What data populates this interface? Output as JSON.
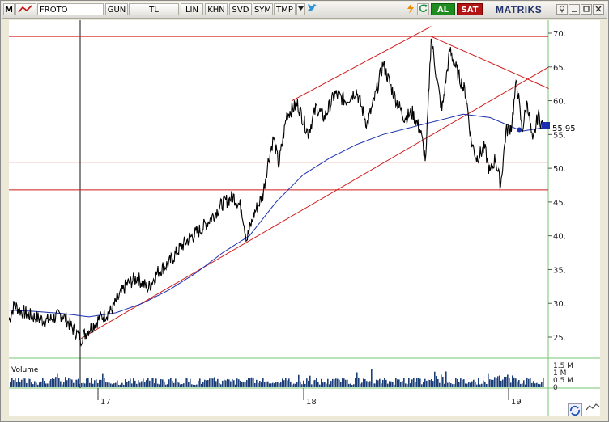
{
  "toolbar": {
    "menu_label": "M",
    "symbol": "FROTO",
    "period": "GUN",
    "currency": "TL",
    "scale": "LIN",
    "khn": "KHN",
    "svd": "SVD",
    "sym": "SYM",
    "tmp": "TMP",
    "buy_label": "AL",
    "sell_label": "SAT",
    "brand": "MATRIKS"
  },
  "chart_data": {
    "type": "line",
    "title": "",
    "price_axis_ticks": [
      "70.",
      "65.",
      "60.",
      "55.",
      "50.",
      "45.",
      "40.",
      "35.",
      "30.",
      "25."
    ],
    "last_price_label": "55.95",
    "volume_label": "Volume",
    "volume_ticks": [
      "1.5 M",
      "1 M",
      "0.5 M",
      "0"
    ],
    "x_ticks": [
      "17",
      "18",
      "19"
    ],
    "ylim": [
      22,
      72
    ],
    "price_series_waypoints": [
      {
        "t": 0.0,
        "v": 27.5
      },
      {
        "t": 0.01,
        "v": 29.8
      },
      {
        "t": 0.02,
        "v": 29.0
      },
      {
        "t": 0.04,
        "v": 28.2
      },
      {
        "t": 0.07,
        "v": 27.4
      },
      {
        "t": 0.1,
        "v": 28.4
      },
      {
        "t": 0.12,
        "v": 26.2
      },
      {
        "t": 0.135,
        "v": 24.8
      },
      {
        "t": 0.15,
        "v": 26.2
      },
      {
        "t": 0.17,
        "v": 27.8
      },
      {
        "t": 0.19,
        "v": 28.8
      },
      {
        "t": 0.22,
        "v": 32.8
      },
      {
        "t": 0.24,
        "v": 33.8
      },
      {
        "t": 0.26,
        "v": 32.2
      },
      {
        "t": 0.28,
        "v": 34.8
      },
      {
        "t": 0.3,
        "v": 36.0
      },
      {
        "t": 0.32,
        "v": 38.2
      },
      {
        "t": 0.34,
        "v": 39.8
      },
      {
        "t": 0.36,
        "v": 41.0
      },
      {
        "t": 0.38,
        "v": 42.8
      },
      {
        "t": 0.4,
        "v": 44.8
      },
      {
        "t": 0.42,
        "v": 45.8
      },
      {
        "t": 0.435,
        "v": 44.2
      },
      {
        "t": 0.445,
        "v": 39.5
      },
      {
        "t": 0.46,
        "v": 43.5
      },
      {
        "t": 0.475,
        "v": 46.0
      },
      {
        "t": 0.485,
        "v": 51.0
      },
      {
        "t": 0.495,
        "v": 54.5
      },
      {
        "t": 0.505,
        "v": 50.5
      },
      {
        "t": 0.52,
        "v": 58.0
      },
      {
        "t": 0.54,
        "v": 59.5
      },
      {
        "t": 0.56,
        "v": 55.2
      },
      {
        "t": 0.575,
        "v": 59.0
      },
      {
        "t": 0.59,
        "v": 57.5
      },
      {
        "t": 0.61,
        "v": 61.0
      },
      {
        "t": 0.63,
        "v": 60.0
      },
      {
        "t": 0.65,
        "v": 61.5
      },
      {
        "t": 0.67,
        "v": 56.5
      },
      {
        "t": 0.685,
        "v": 60.5
      },
      {
        "t": 0.7,
        "v": 65.5
      },
      {
        "t": 0.715,
        "v": 62.0
      },
      {
        "t": 0.725,
        "v": 60.0
      },
      {
        "t": 0.74,
        "v": 57.5
      },
      {
        "t": 0.755,
        "v": 58.2
      },
      {
        "t": 0.77,
        "v": 55.5
      },
      {
        "t": 0.78,
        "v": 51.0
      },
      {
        "t": 0.79,
        "v": 69.5
      },
      {
        "t": 0.8,
        "v": 63.5
      },
      {
        "t": 0.81,
        "v": 58.5
      },
      {
        "t": 0.825,
        "v": 67.5
      },
      {
        "t": 0.84,
        "v": 64.0
      },
      {
        "t": 0.855,
        "v": 61.0
      },
      {
        "t": 0.865,
        "v": 54.0
      },
      {
        "t": 0.875,
        "v": 51.5
      },
      {
        "t": 0.89,
        "v": 53.0
      },
      {
        "t": 0.9,
        "v": 49.2
      },
      {
        "t": 0.91,
        "v": 51.5
      },
      {
        "t": 0.92,
        "v": 47.5
      },
      {
        "t": 0.93,
        "v": 55.5
      },
      {
        "t": 0.94,
        "v": 56.2
      },
      {
        "t": 0.95,
        "v": 63.0
      },
      {
        "t": 0.96,
        "v": 55.5
      },
      {
        "t": 0.97,
        "v": 60.0
      },
      {
        "t": 0.98,
        "v": 53.5
      },
      {
        "t": 0.99,
        "v": 58.0
      },
      {
        "t": 1.0,
        "v": 55.9
      }
    ],
    "moving_average_waypoints": [
      {
        "t": 0.0,
        "v": 29.0
      },
      {
        "t": 0.05,
        "v": 28.8
      },
      {
        "t": 0.1,
        "v": 28.5
      },
      {
        "t": 0.15,
        "v": 28.0
      },
      {
        "t": 0.2,
        "v": 28.6
      },
      {
        "t": 0.25,
        "v": 30.0
      },
      {
        "t": 0.3,
        "v": 32.0
      },
      {
        "t": 0.35,
        "v": 34.5
      },
      {
        "t": 0.4,
        "v": 37.5
      },
      {
        "t": 0.45,
        "v": 40.0
      },
      {
        "t": 0.5,
        "v": 45.0
      },
      {
        "t": 0.55,
        "v": 49.0
      },
      {
        "t": 0.6,
        "v": 51.5
      },
      {
        "t": 0.65,
        "v": 53.5
      },
      {
        "t": 0.7,
        "v": 55.0
      },
      {
        "t": 0.75,
        "v": 56.0
      },
      {
        "t": 0.8,
        "v": 57.0
      },
      {
        "t": 0.85,
        "v": 58.0
      },
      {
        "t": 0.9,
        "v": 57.5
      },
      {
        "t": 0.93,
        "v": 56.5
      },
      {
        "t": 0.96,
        "v": 55.5
      },
      {
        "t": 1.0,
        "v": 56.0
      }
    ],
    "horizontal_levels": [
      69.5,
      50.9,
      46.8
    ],
    "colors": {
      "price": "#000000",
      "moving_average": "#1a2fb0",
      "trendline": "#d11a1a",
      "volume": "#1d3f78",
      "grid_frame": "#76c776",
      "last_price_box": "#1a2fb0"
    },
    "grid": false,
    "legend": "none"
  }
}
